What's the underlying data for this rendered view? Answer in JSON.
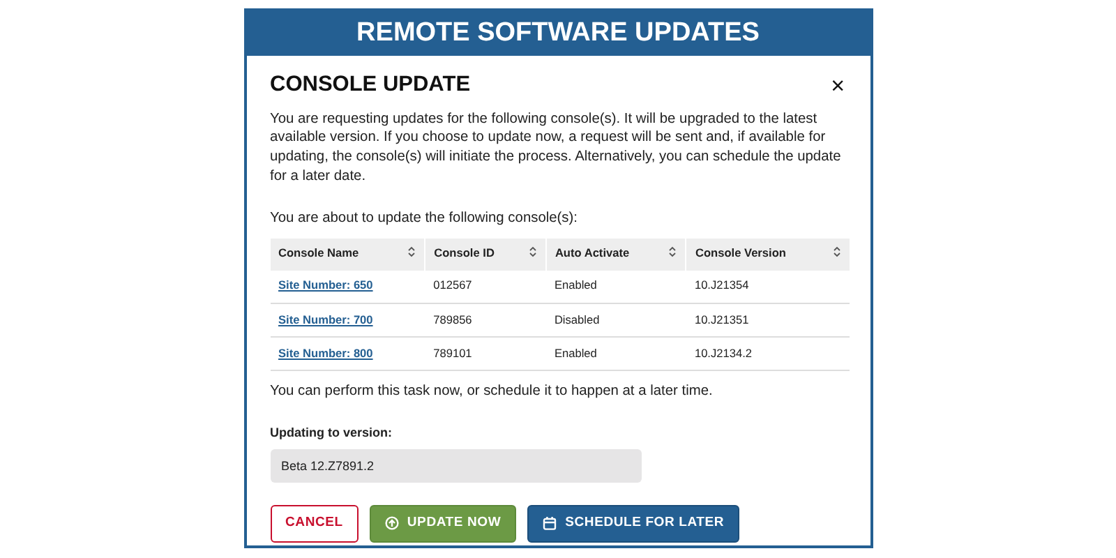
{
  "banner": {
    "title": "REMOTE SOFTWARE UPDATES"
  },
  "dialog": {
    "title": "CONSOLE UPDATE",
    "close": "×",
    "intro": "You are requesting updates for the following console(s). It will be upgraded to the latest available version. If you choose to update now, a request will be sent and, if available for updating, the console(s) will initiate the process. Alternatively, you can schedule the update for a later date.",
    "table_caption": "You are about to update the following console(s):",
    "table": {
      "columns": [
        "Console Name",
        "Console ID",
        "Auto Activate",
        "Console Version"
      ],
      "rows": [
        {
          "name": "Site Number: 650",
          "id": "012567",
          "auto_activate": "Enabled",
          "version": "10.J21354"
        },
        {
          "name": "Site Number: 700",
          "id": "789856",
          "auto_activate": "Disabled",
          "version": "10.J21351"
        },
        {
          "name": "Site Number: 800",
          "id": "789101",
          "auto_activate": "Enabled",
          "version": "10.J2134.2"
        }
      ]
    },
    "note": "You can perform this task now, or schedule it to happen at a later time.",
    "version_field": {
      "label": "Updating to version:",
      "value": "Beta 12.Z7891.2",
      "disabled": true
    },
    "buttons": [
      {
        "kind": "cancel",
        "label": "CANCEL"
      },
      {
        "kind": "update",
        "label": "UPDATE NOW"
      },
      {
        "kind": "schedule",
        "label": "SCHEDULE FOR LATER"
      }
    ]
  }
}
